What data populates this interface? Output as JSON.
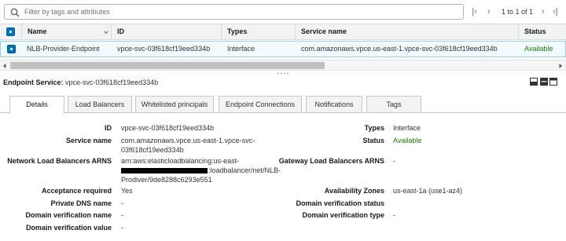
{
  "filter": {
    "placeholder": "Filter by tags and attributes",
    "value": ""
  },
  "pager": {
    "first": "|‹",
    "prev": "‹",
    "text": "1 to 1 of 1",
    "next": "›",
    "last": "›|"
  },
  "table": {
    "headers": {
      "name": "Name",
      "id": "ID",
      "types": "Types",
      "service_name": "Service name",
      "status": "Status"
    },
    "row": {
      "name": "NLB-Provider-Endpoint",
      "id": "vpce-svc-03f618cf19eed334b",
      "types": "Interface",
      "service_name": "com.amazonaws.vpce.us-east-1.vpce-svc-03f618cf19eed334b",
      "status": "Available"
    }
  },
  "details": {
    "title_label": "Endpoint Service:",
    "title_value": "vpce-svc-03f618cf19eed334b",
    "tabs": [
      "Details",
      "Load Balancers",
      "Whitelisted principals",
      "Endpoint Connections",
      "Notifications",
      "Tags"
    ],
    "active_tab": "Details",
    "left": {
      "id_label": "ID",
      "id_value": "vpce-svc-03f618cf19eed334b",
      "service_name_label": "Service name",
      "service_name_line1": "com.amazonaws.vpce.us-east-1.vpce-svc-",
      "service_name_line2": "03f618cf19eed334b",
      "nlb_arns_label": "Network Load Balancers ARNS",
      "nlb_arns_line1": "arn:aws:elasticloadbalancing:us-east-",
      "nlb_arns_line2_suffix": ":loadbalancer/net/NLB-",
      "nlb_arns_line3": "Prodiver/9de8288c6293e551",
      "acceptance_label": "Acceptance required",
      "acceptance_value": "Yes",
      "private_dns_label": "Private DNS name",
      "private_dns_value": "-",
      "domain_verif_name_label": "Domain verification name",
      "domain_verif_name_value": "-",
      "domain_verif_value_label": "Domain verification value",
      "domain_verif_value_value": "-"
    },
    "right": {
      "types_label": "Types",
      "types_value": "Interface",
      "status_label": "Status",
      "status_value": "Available",
      "gwlb_arns_label": "Gateway Load Balancers ARNS",
      "gwlb_arns_value": "-",
      "az_label": "Availability Zones",
      "az_value": "us-east-1a (use1-az4)",
      "domain_verif_status_label": "Domain verification status",
      "domain_verif_status_value": "",
      "domain_verif_type_label": "Domain verification type",
      "domain_verif_type_value": "-"
    }
  },
  "colors": {
    "accent": "#0073bb",
    "available": "#1d8102",
    "selected_row": "#f1faff"
  }
}
